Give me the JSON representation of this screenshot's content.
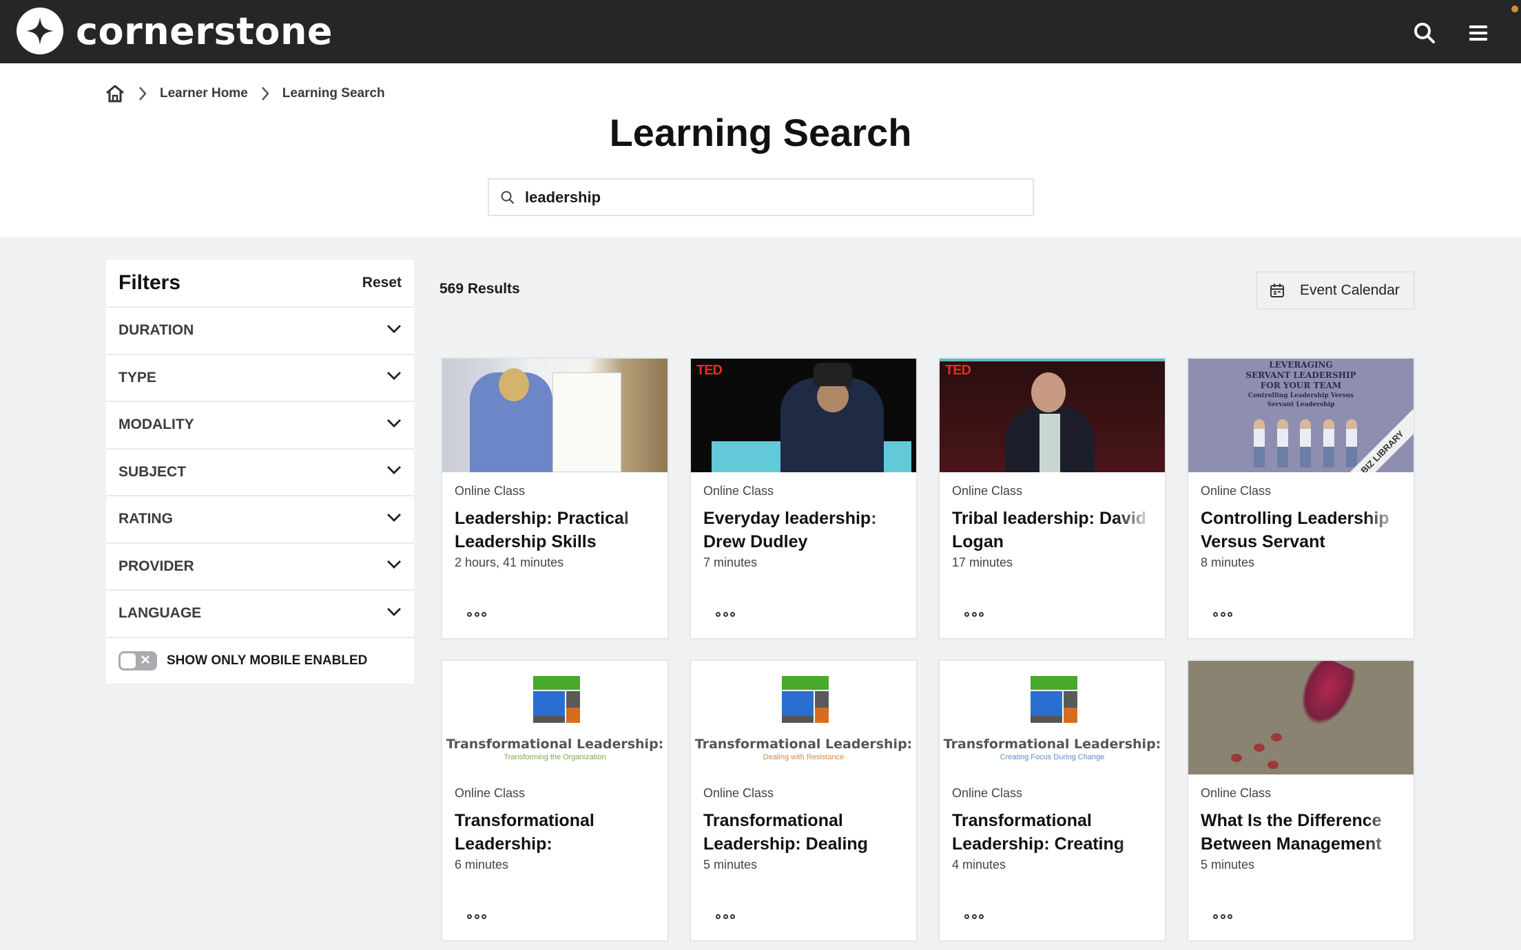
{
  "app": {
    "brand": "cornerstone",
    "icons": {
      "search": "search-icon",
      "menu": "hamburger-menu-icon",
      "logo": "cornerstone-star-icon"
    }
  },
  "breadcrumb": {
    "home_icon": "home-icon",
    "items": [
      "Learner Home",
      "Learning Search"
    ]
  },
  "page": {
    "title": "Learning Search"
  },
  "search": {
    "value": "leadership",
    "icon": "search-icon"
  },
  "filters": {
    "title": "Filters",
    "reset_label": "Reset",
    "items": [
      {
        "label": "DURATION"
      },
      {
        "label": "TYPE"
      },
      {
        "label": "MODALITY"
      },
      {
        "label": "SUBJECT"
      },
      {
        "label": "RATING"
      },
      {
        "label": "PROVIDER"
      },
      {
        "label": "LANGUAGE"
      }
    ],
    "mobile_toggle": {
      "label": "SHOW ONLY MOBILE ENABLED",
      "on": false
    }
  },
  "results": {
    "count_label": "569 Results",
    "event_calendar_label": "Event Calendar",
    "cards": [
      {
        "type": "Online Class",
        "title": "Leadership: Practical Leadership Skills",
        "duration": "2 hours, 41 minutes"
      },
      {
        "type": "Online Class",
        "title": "Everyday leadership: Drew Dudley",
        "duration": "7 minutes",
        "thumb_badge": "TED"
      },
      {
        "type": "Online Class",
        "title": "Tribal leadership: David Logan",
        "duration": "17 minutes",
        "thumb_badge": "TED"
      },
      {
        "type": "Online Class",
        "title": "Controlling Leadership Versus Servant",
        "duration": "8 minutes",
        "thumb_text": {
          "line1": "LEVERAGING",
          "line2": "SERVANT LEADERSHIP",
          "line3": "FOR YOUR TEAM",
          "sub1": "Controlling Leadership Versus",
          "sub2": "Servant Leadership",
          "banner": "BIZ LIBRARY"
        }
      },
      {
        "type": "Online Class",
        "title": "Transformational Leadership:",
        "duration": "6 minutes",
        "thumb_text": {
          "title": "Transformational Leadership:",
          "subtitle": "Transforming the Organization",
          "subtitle_color": "#7aa84a"
        }
      },
      {
        "type": "Online Class",
        "title": "Transformational Leadership: Dealing",
        "duration": "5 minutes",
        "thumb_text": {
          "title": "Transformational Leadership:",
          "subtitle": "Dealing with Resistance",
          "subtitle_color": "#d0884a"
        }
      },
      {
        "type": "Online Class",
        "title": "Transformational Leadership: Creating",
        "duration": "4 minutes",
        "thumb_text": {
          "title": "Transformational Leadership:",
          "subtitle": "Creating Focus During Change",
          "subtitle_color": "#5a8cc0"
        }
      },
      {
        "type": "Online Class",
        "title": "What Is the Difference Between Management",
        "duration": "5 minutes"
      }
    ]
  },
  "colors": {
    "topbar": "#262626",
    "page_bg": "#f0f1f3",
    "card_bg": "#ffffff",
    "toggle_off": "#a9abae",
    "ted_red": "#e62b1e"
  }
}
